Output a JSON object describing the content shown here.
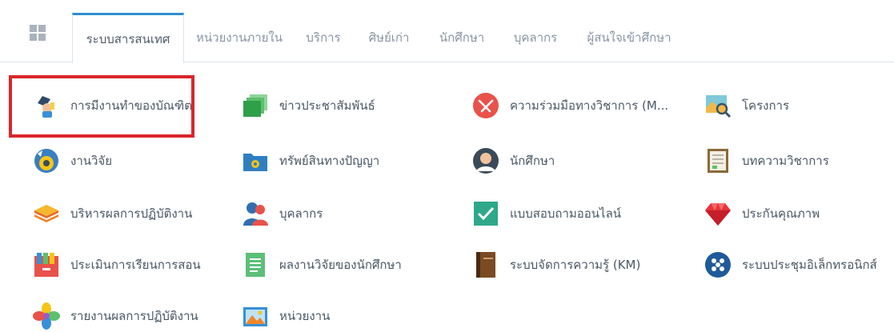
{
  "tabs": [
    {
      "label": "ระบบสารสนเทศ",
      "active": true
    },
    {
      "label": "หน่วยงานภายใน",
      "active": false
    },
    {
      "label": "บริการ",
      "active": false
    },
    {
      "label": "ศิษย์เก่า",
      "active": false
    },
    {
      "label": "นักศึกษา",
      "active": false
    },
    {
      "label": "บุคลากร",
      "active": false
    },
    {
      "label": "ผู้สนใจเข้าศึกษา",
      "active": false
    }
  ],
  "home_icon": "windows-grid-icon",
  "apps": [
    {
      "label": "การมีงานทำของบัณฑิต",
      "icon": "graduate-employment-icon"
    },
    {
      "label": "ข่าวประชาสัมพันธ์",
      "icon": "news-stack-icon"
    },
    {
      "label": "ความร่วมมือทางวิชาการ (M...",
      "icon": "handshake-icon"
    },
    {
      "label": "โครงการ",
      "icon": "project-map-icon"
    },
    {
      "label": "งานวิจัย",
      "icon": "research-globe-icon"
    },
    {
      "label": "ทรัพย์สินทางปัญญา",
      "icon": "folder-gear-icon"
    },
    {
      "label": "นักศึกษา",
      "icon": "student-avatar-icon"
    },
    {
      "label": "บทความวิชาการ",
      "icon": "article-document-icon"
    },
    {
      "label": "บริหารผลการปฏิบัติงาน",
      "icon": "layers-icon"
    },
    {
      "label": "บุคลากร",
      "icon": "people-icon"
    },
    {
      "label": "แบบสอบถามออนไลน์",
      "icon": "checkmark-survey-icon"
    },
    {
      "label": "ประกันคุณภาพ",
      "icon": "ruby-gem-icon"
    },
    {
      "label": "ประเมินการเรียนการสอน",
      "icon": "file-cabinet-icon"
    },
    {
      "label": "ผลงานวิจัยของนักศึกษา",
      "icon": "document-lines-icon"
    },
    {
      "label": "ระบบจัดการความรู้ (KM)",
      "icon": "notebook-icon"
    },
    {
      "label": "ระบบประชุมอิเล็กทรอนิกส์",
      "icon": "meeting-dots-icon"
    },
    {
      "label": "รายงานผลการปฏิบัติงาน",
      "icon": "petal-chart-icon"
    },
    {
      "label": "หน่วยงาน",
      "icon": "landscape-picture-icon"
    }
  ],
  "colors": {
    "active_tab_accent": "#2f8fcf",
    "highlight_border": "#d9262c"
  }
}
